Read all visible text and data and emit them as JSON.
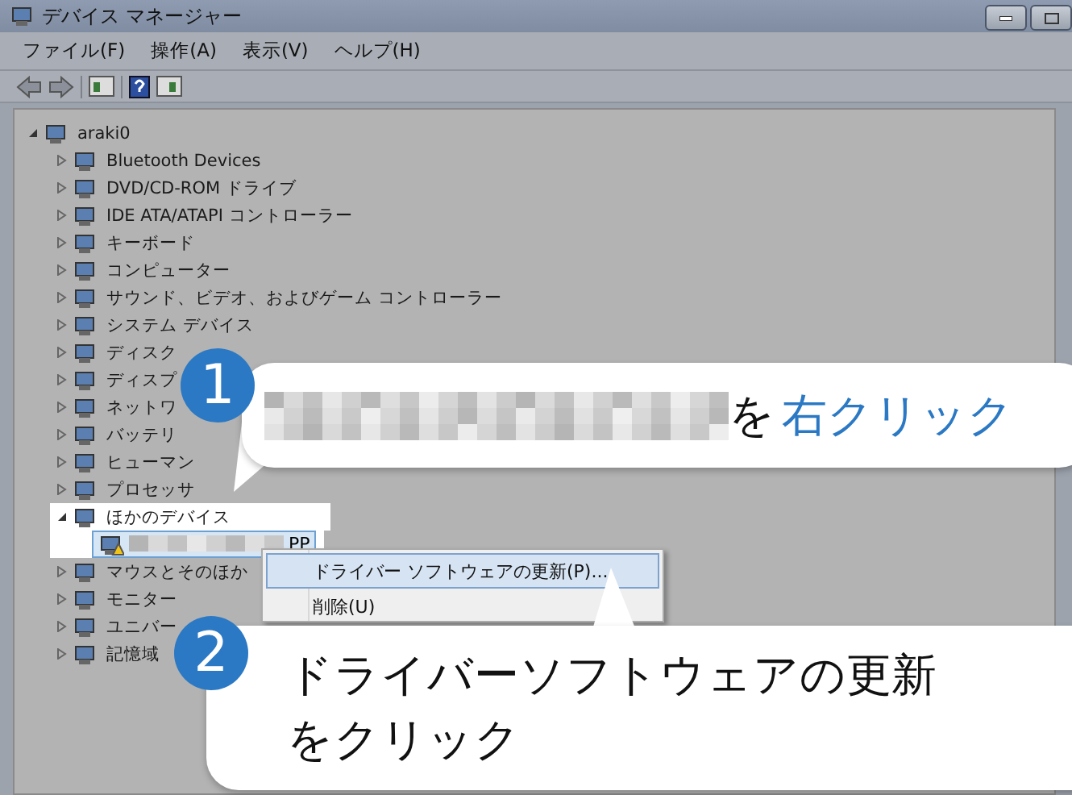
{
  "window": {
    "title": "デバイス マネージャー"
  },
  "menu": [
    {
      "label": "ファイル(F)"
    },
    {
      "label": "操作(A)"
    },
    {
      "label": "表示(V)"
    },
    {
      "label": "ヘルプ(H)"
    }
  ],
  "tree": {
    "label": "araki0",
    "expanded": true,
    "selected": false,
    "children": [
      {
        "label": "Bluetooth Devices",
        "expanded": false,
        "selected": false
      },
      {
        "label": "DVD/CD-ROM ドライブ",
        "expanded": false,
        "selected": false
      },
      {
        "label": "IDE ATA/ATAPI コントローラー",
        "expanded": false,
        "selected": false
      },
      {
        "label": "キーボード",
        "expanded": false,
        "selected": false
      },
      {
        "label": "コンピューター",
        "expanded": false,
        "selected": false
      },
      {
        "label": "サウンド、ビデオ、およびゲーム コントローラー",
        "expanded": false,
        "selected": false
      },
      {
        "label": "システム デバイス",
        "expanded": false,
        "selected": false
      },
      {
        "label": "ディスク",
        "expanded": false,
        "selected": false
      },
      {
        "label": "ディスプ",
        "expanded": false,
        "selected": false
      },
      {
        "label": "ネットワ",
        "expanded": false,
        "selected": false
      },
      {
        "label": "バッテリ",
        "expanded": false,
        "selected": false
      },
      {
        "label": "ヒューマン",
        "expanded": false,
        "selected": false
      },
      {
        "label": "プロセッサ",
        "expanded": false,
        "selected": false
      },
      {
        "label": "ほかのデバイス",
        "expanded": true,
        "selected": false,
        "spotlight": true,
        "children": [
          {
            "label": "PP",
            "selected": true,
            "warning": true
          }
        ]
      },
      {
        "label": "マウスとそのほか",
        "expanded": false,
        "selected": false
      },
      {
        "label": "モニター",
        "expanded": false,
        "selected": false
      },
      {
        "label": "ユニバー",
        "expanded": false,
        "selected": false
      },
      {
        "label": "記憶域",
        "expanded": false,
        "selected": false
      }
    ]
  },
  "context_menu": [
    {
      "label": "ドライバー ソフトウェアの更新(P)...",
      "selected": true
    },
    {
      "label": "削除(U)",
      "selected": false
    }
  ],
  "callouts": [
    {
      "number": "1",
      "text": "を",
      "highlight": "右クリック"
    },
    {
      "number": "2",
      "text": "ドライバーソフトウェアの更新をクリック"
    }
  ]
}
